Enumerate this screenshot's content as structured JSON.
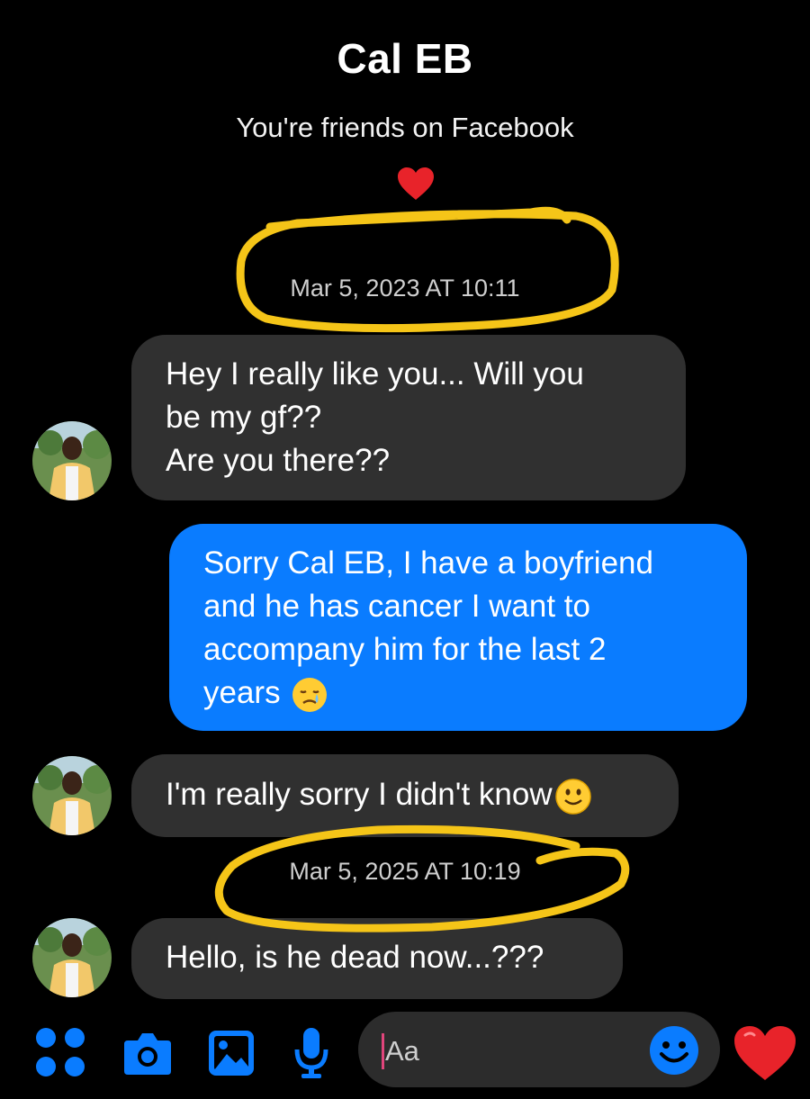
{
  "header": {
    "contact_name": "Cal EB",
    "relationship_text": "You're friends on Facebook"
  },
  "messages": [
    {
      "type": "timestamp",
      "text": "Mar 5, 2023 AT 10:11"
    },
    {
      "type": "incoming",
      "lines": [
        "Hey I really like you... Will you",
        "be my gf??",
        "Are you there??"
      ]
    },
    {
      "type": "outgoing",
      "lines": [
        "Sorry Cal EB, I have a boyfriend",
        "and he has cancer I want to",
        "accompany him for the last 2",
        "years"
      ],
      "emoji": "sad-face"
    },
    {
      "type": "incoming",
      "text": "I'm really sorry I didn't know",
      "emoji": "smiley-face"
    },
    {
      "type": "timestamp",
      "text": "Mar 5, 2025 AT 10:19"
    },
    {
      "type": "incoming",
      "text": "Hello, is he dead now...???"
    }
  ],
  "composer": {
    "placeholder": "Aa"
  },
  "icons": [
    "heart-icon",
    "apps-grid-icon",
    "camera-icon",
    "gallery-icon",
    "microphone-icon",
    "emoji-icon",
    "like-heart-icon"
  ],
  "colors": {
    "background": "#000000",
    "incoming_bubble": "#303030",
    "outgoing_bubble": "#0a7cff",
    "accent_blue": "#0a7cff",
    "heart_red": "#e8232a",
    "highlight_circle": "#f5c518"
  }
}
